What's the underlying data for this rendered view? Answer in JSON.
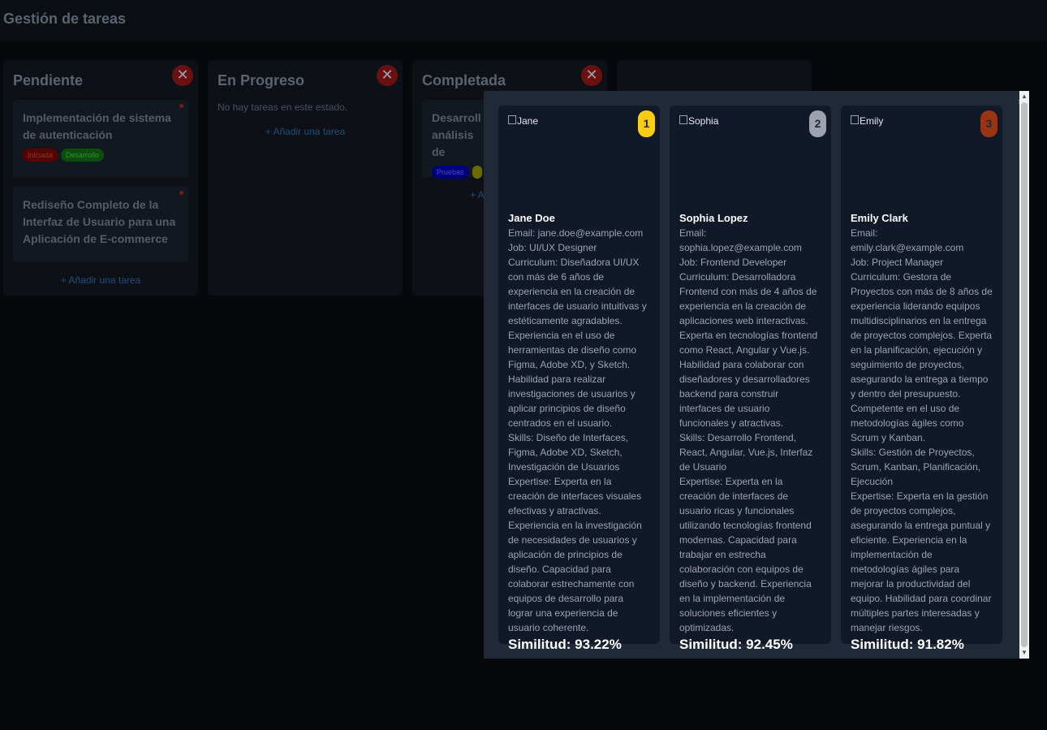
{
  "header": {
    "title": "Gestión de tareas"
  },
  "columns": [
    {
      "title": "Pendiente",
      "close": "✕",
      "tasks": [
        {
          "title": "Implementación de sistema de autenticación",
          "tags": [
            "Iniciada",
            "Desarrollo"
          ]
        },
        {
          "title": "Rediseño Completo de la Interfaz de Usuario para una Aplicación de E-commerce"
        }
      ],
      "add": "+ Añadir una tarea"
    },
    {
      "title": "En Progreso",
      "close": "✕",
      "empty": "No hay tareas en este estado.",
      "add": "+ Añadir una tarea"
    },
    {
      "title": "Completada",
      "close": "✕",
      "tasks": [
        {
          "title": "Desarrollo análisis de",
          "tags": [
            "Pruebas",
            ""
          ]
        }
      ],
      "add": "+ A"
    }
  ],
  "modal": {
    "close": "×",
    "candidates": [
      {
        "rank": "1",
        "rank_color": "#facc15",
        "img_alt": "Jane",
        "name": "Jane Doe",
        "email": "Email: jane.doe@example.com",
        "job": "Job: UI/UX Designer",
        "curriculum": "Curriculum: Diseñadora UI/UX con más de 6 años de experiencia en la creación de interfaces de usuario intuitivas y estéticamente agradables. Experiencia en el uso de herramientas de diseño como Figma, Adobe XD, y Sketch. Habilidad para realizar investigaciones de usuarios y aplicar principios de diseño centrados en el usuario.",
        "skills": "Skills: Diseño de Interfaces, Figma, Adobe XD, Sketch, Investigación de Usuarios",
        "expertise": "Expertise: Experta en la creación de interfaces visuales efectivas y atractivas. Experiencia en la investigación de necesidades de usuarios y aplicación de principios de diseño. Capacidad para colaborar estrechamente con equipos de desarrollo para lograr una experiencia de usuario coherente.",
        "similarity": "Similitud: 93.22%"
      },
      {
        "rank": "2",
        "rank_color": "#9ca3af",
        "img_alt": "Sophia",
        "name": "Sophia Lopez",
        "email": "Email: sophia.lopez@example.com",
        "job": "Job: Frontend Developer",
        "curriculum": "Curriculum: Desarrolladora Frontend con más de 4 años de experiencia en la creación de aplicaciones web interactivas. Experta en tecnologías frontend como React, Angular y Vue.js. Habilidad para colaborar con diseñadores y desarrolladores backend para construir interfaces de usuario funcionales y atractivas.",
        "skills": "Skills: Desarrollo Frontend, React, Angular, Vue.js, Interfaz de Usuario",
        "expertise": "Expertise: Experta en la creación de interfaces de usuario ricas y funcionales utilizando tecnologías frontend modernas. Capacidad para trabajar en estrecha colaboración con equipos de diseño y backend. Experiencia en la implementación de soluciones eficientes y optimizadas.",
        "similarity": "Similitud: 92.45%"
      },
      {
        "rank": "3",
        "rank_color": "#9a3412",
        "img_alt": "Emily",
        "name": "Emily Clark",
        "email": "Email: emily.clark@example.com",
        "job": "Job: Project Manager",
        "curriculum": "Curriculum: Gestora de Proyectos con más de 8 años de experiencia liderando equipos multidisciplinarios en la entrega de proyectos complejos. Experta en la planificación, ejecución y seguimiento de proyectos, asegurando la entrega a tiempo y dentro del presupuesto. Competente en el uso de metodologías ágiles como Scrum y Kanban.",
        "skills": "Skills: Gestión de Proyectos, Scrum, Kanban, Planificación, Ejecución",
        "expertise": "Expertise: Experta en la gestión de proyectos complejos, asegurando la entrega puntual y eficiente. Experiencia en la implementación de metodologías ágiles para mejorar la productividad del equipo. Habilidad para coordinar múltiples partes interesadas y manejar riesgos.",
        "similarity": "Similitud: 91.82%"
      }
    ]
  },
  "scrollbar": {
    "up": "▲",
    "down": "▼"
  }
}
